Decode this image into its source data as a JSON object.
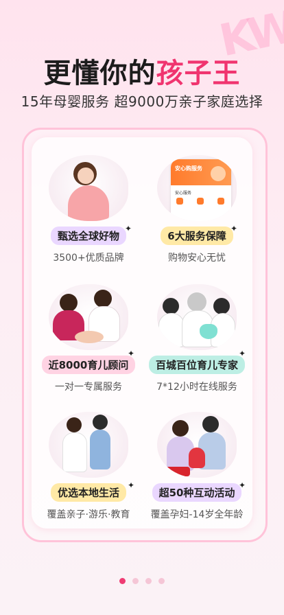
{
  "brand_mark": "KW",
  "header": {
    "title_prefix": "更懂你的",
    "title_accent": "孩子王",
    "subtitle": "15年母婴服务  超9000万亲子家庭选择"
  },
  "features": [
    {
      "label": "甄选全球好物",
      "desc": "3500+优质品牌"
    },
    {
      "label": "6大服务保障",
      "desc": "购物安心无忧"
    },
    {
      "label": "近8000育儿顾问",
      "desc": "一对一专属服务"
    },
    {
      "label": "百城百位育儿专家",
      "desc": "7*12小时在线服务"
    },
    {
      "label": "优选本地生活",
      "desc": "覆盖亲子·游乐·教育"
    },
    {
      "label": "超50种互动活动",
      "desc": "覆盖孕妇-14岁全年龄"
    }
  ],
  "phone_card": {
    "title": "安心购服务",
    "section": "安心服务"
  },
  "pager": {
    "count": 4,
    "active": 1
  },
  "colors": {
    "accent": "#f0346f",
    "pager_active": "#ef3b73"
  }
}
